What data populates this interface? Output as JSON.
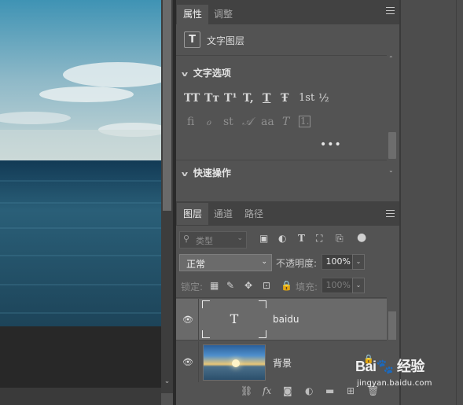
{
  "properties_panel": {
    "tabs": [
      "属性",
      "调整"
    ],
    "active_tab": "属性",
    "layer_kind_icon": "T",
    "layer_kind_label": "文字图层",
    "text_options": {
      "title": "文字选项",
      "row1": [
        "TT",
        "Tᴛ",
        "T¹",
        "T,",
        "T",
        "Ŧ",
        "1st",
        "½"
      ],
      "row2": [
        "fi",
        "ℴ",
        "st",
        "𝒜",
        "aa",
        "T",
        "1."
      ],
      "more": "•••"
    },
    "quick_actions": {
      "title": "快速操作"
    }
  },
  "layers_panel": {
    "tabs": [
      "图层",
      "通道",
      "路径"
    ],
    "active_tab": "图层",
    "filter_kind": "类型",
    "blend_mode": "正常",
    "opacity_label": "不透明度:",
    "opacity_value": "100%",
    "lock_label": "锁定:",
    "fill_label": "填充:",
    "fill_value": "100%",
    "layers": [
      {
        "name": "baidu",
        "kind": "text",
        "thumb": "T",
        "selected": true,
        "visible": true
      },
      {
        "name": "背景",
        "kind": "image",
        "selected": false,
        "visible": true,
        "locked": true
      }
    ],
    "bottom_icons": [
      "link-icon",
      "fx-icon",
      "mask-icon",
      "adjustment-icon",
      "folder-icon",
      "new-layer-icon",
      "trash-icon"
    ],
    "fx_label": "fx"
  },
  "watermark": {
    "logo": "Bai🐾 经验",
    "sub": "jingyan.baidu.com"
  }
}
